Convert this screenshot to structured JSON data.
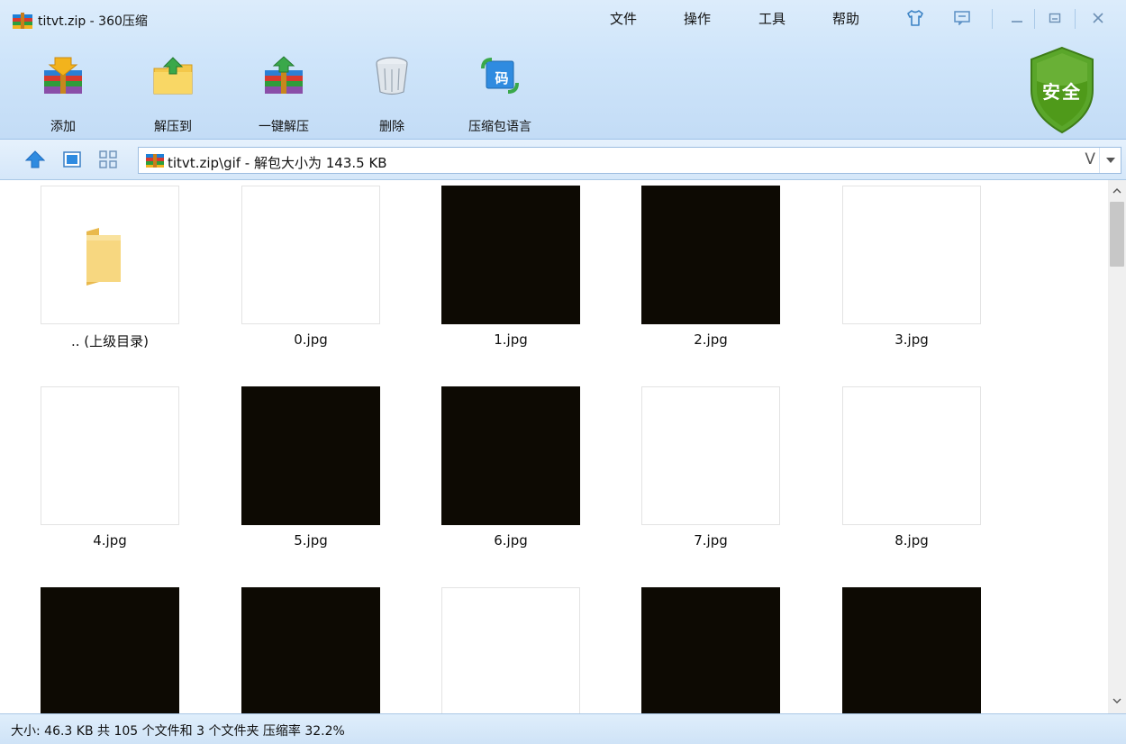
{
  "window": {
    "title": "titvt.zip - 360压缩"
  },
  "menu": {
    "file": "文件",
    "operate": "操作",
    "tools": "工具",
    "help": "帮助"
  },
  "toolbar": {
    "add_label": "添加",
    "extract_to_label": "解压到",
    "one_click_extract_label": "一键解压",
    "delete_label": "删除",
    "language_label": "压缩包语言",
    "language_icon_char": "码"
  },
  "security": {
    "label": "安全"
  },
  "address": {
    "path": "titvt.zip\\gif - 解包大小为 143.5 KB",
    "v_label": "V"
  },
  "files": [
    {
      "name": ".. (上级目录)",
      "thumb": "folder"
    },
    {
      "name": "0.jpg",
      "thumb": "white"
    },
    {
      "name": "1.jpg",
      "thumb": "black"
    },
    {
      "name": "2.jpg",
      "thumb": "black"
    },
    {
      "name": "3.jpg",
      "thumb": "white"
    },
    {
      "name": "4.jpg",
      "thumb": "white"
    },
    {
      "name": "5.jpg",
      "thumb": "black"
    },
    {
      "name": "6.jpg",
      "thumb": "black"
    },
    {
      "name": "7.jpg",
      "thumb": "white"
    },
    {
      "name": "8.jpg",
      "thumb": "white"
    },
    {
      "name": "",
      "thumb": "black"
    },
    {
      "name": "",
      "thumb": "black"
    },
    {
      "name": "",
      "thumb": "white"
    },
    {
      "name": "",
      "thumb": "black"
    },
    {
      "name": "",
      "thumb": "black"
    }
  ],
  "status": {
    "text": "大小: 46.3 KB 共 105 个文件和 3 个文件夹 压缩率 32.2%"
  },
  "colors": {
    "header_bg": "#cfe5fa",
    "tile_black": "#0d0a03",
    "shield_green": "#4f9a1a"
  },
  "icons": [
    "app-zip-icon",
    "skin-icon",
    "feedback-icon",
    "minimize-icon",
    "maximize-icon",
    "close-icon",
    "up-arrow-icon",
    "view-large-icon",
    "view-grid-icon",
    "folder-icon",
    "shield-icon",
    "dropdown-icon",
    "scroll-up-icon",
    "scroll-down-icon"
  ]
}
